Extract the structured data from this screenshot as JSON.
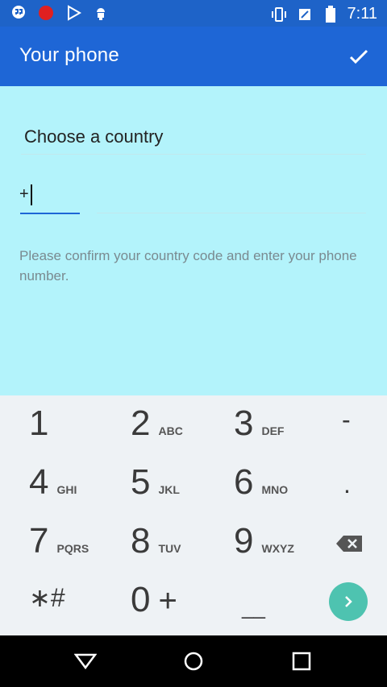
{
  "status_bar": {
    "time": "7:11",
    "left_icons": [
      "hangouts-icon",
      "record-icon",
      "play-store-icon",
      "android-icon"
    ],
    "right_icons": [
      "vibrate-icon",
      "no-sim-icon",
      "battery-icon"
    ]
  },
  "app_bar": {
    "title": "Your phone",
    "confirm_icon": "check-icon"
  },
  "form": {
    "country_placeholder": "Choose a country",
    "code_value": "+",
    "phone_value": "",
    "hint": "Please confirm your country code and enter your phone number."
  },
  "keypad": {
    "rows": [
      [
        {
          "num": "1",
          "letters": ""
        },
        {
          "num": "2",
          "letters": "ABC"
        },
        {
          "num": "3",
          "letters": "DEF"
        }
      ],
      [
        {
          "num": "4",
          "letters": "GHI"
        },
        {
          "num": "5",
          "letters": "JKL"
        },
        {
          "num": "6",
          "letters": "MNO"
        }
      ],
      [
        {
          "num": "7",
          "letters": "PQRS"
        },
        {
          "num": "8",
          "letters": "TUV"
        },
        {
          "num": "9",
          "letters": "WXYZ"
        }
      ]
    ],
    "star_hash": "∗#",
    "zero": "0",
    "plus": "+",
    "underscore": "__",
    "minus": "-",
    "dot": ".",
    "backspace_icon": "backspace-icon",
    "next_icon": "chevron-right-icon"
  },
  "nav_bar": {
    "icons": [
      "back-icon",
      "home-icon",
      "recents-icon"
    ]
  },
  "colors": {
    "status_bar": "#1e63c8",
    "app_bar": "#1e66d6",
    "background": "#b3f3fb",
    "keypad_bg": "#eef2f5",
    "accent_green": "#4ec3b0"
  }
}
